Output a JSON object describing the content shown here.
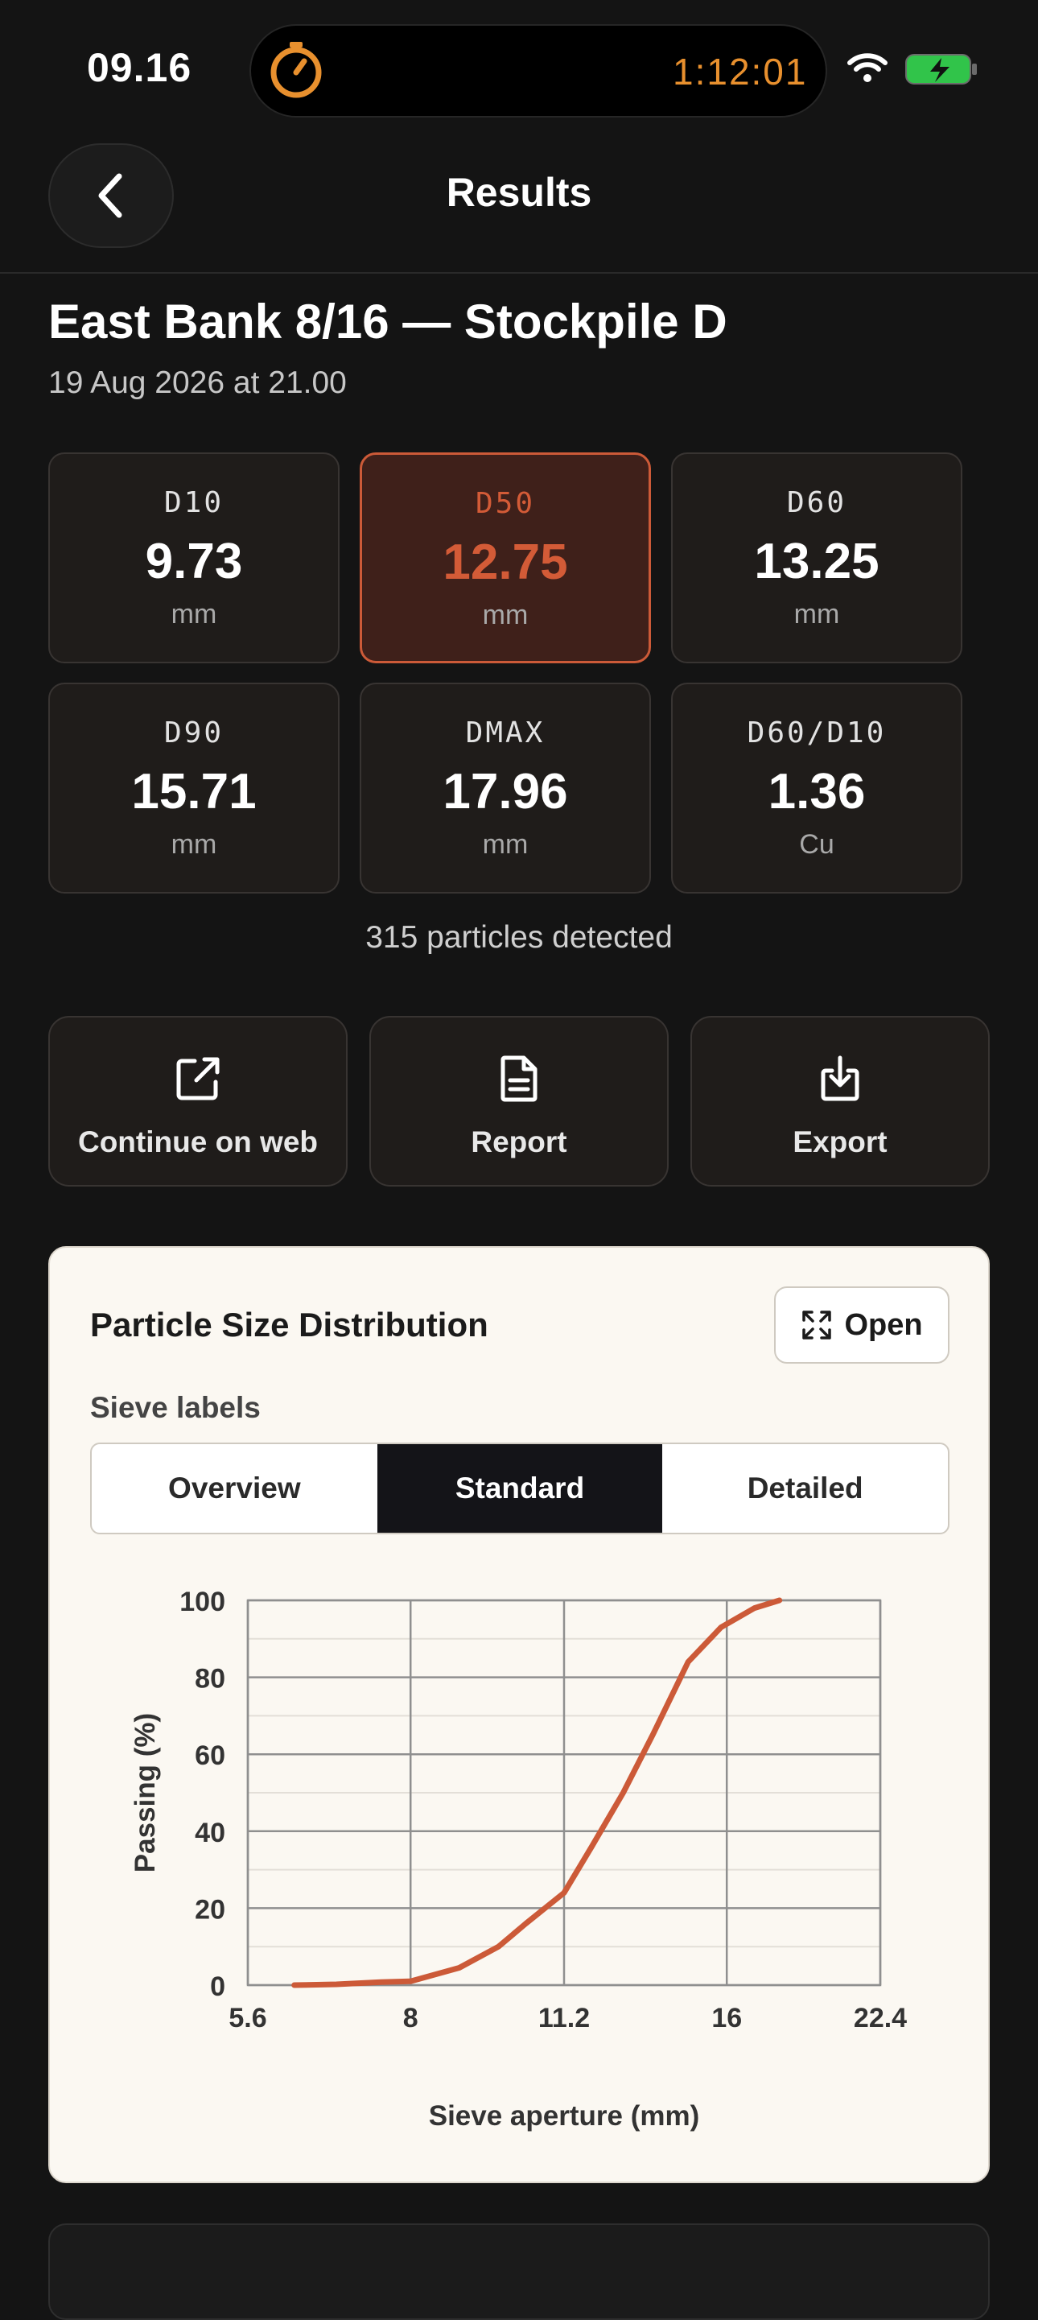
{
  "status_bar": {
    "time": "09.16",
    "timer": "1:12:01"
  },
  "nav": {
    "title": "Results"
  },
  "sample": {
    "title": "East Bank 8/16 — Stockpile D",
    "date": "19 Aug 2026 at 21.00"
  },
  "metrics": [
    {
      "label": "D10",
      "value": "9.73",
      "unit": "mm"
    },
    {
      "label": "D50",
      "value": "12.75",
      "unit": "mm"
    },
    {
      "label": "D60",
      "value": "13.25",
      "unit": "mm"
    },
    {
      "label": "D90",
      "value": "15.71",
      "unit": "mm"
    },
    {
      "label": "DMAX",
      "value": "17.96",
      "unit": "mm"
    },
    {
      "label": "D60/D10",
      "value": "1.36",
      "unit": "Cu"
    }
  ],
  "particles_text": "315 particles detected",
  "actions": {
    "web": "Continue on web",
    "report": "Report",
    "export": "Export"
  },
  "card": {
    "title": "Particle Size Distribution",
    "open_label": "Open",
    "sieve_caption": "Sieve labels",
    "segments": [
      "Overview",
      "Standard",
      "Detailed"
    ]
  },
  "colors": {
    "accent": "#cc5a38",
    "background": "#141414",
    "card": "#fbf8f2"
  },
  "chart_data": {
    "type": "line",
    "xlabel": "Sieve aperture (mm)",
    "ylabel": "Passing (%)",
    "x_ticks": [
      "5.6",
      "8",
      "11.2",
      "16",
      "22.4"
    ],
    "y_ticks": [
      "0",
      "20",
      "40",
      "60",
      "80",
      "100"
    ],
    "ylim": [
      0,
      100
    ],
    "xscale": "log",
    "grid": true,
    "series": [
      {
        "x": [
          6.2,
          6.8,
          7.5,
          8.0,
          8.9,
          9.7,
          10.3,
          11.2,
          11.9,
          12.75,
          13.6,
          14.7,
          15.8,
          17.0,
          17.96
        ],
        "y": [
          0,
          0.2,
          0.8,
          1,
          4.5,
          10,
          16,
          24,
          36,
          50,
          65,
          84,
          93,
          98,
          100
        ]
      }
    ]
  }
}
